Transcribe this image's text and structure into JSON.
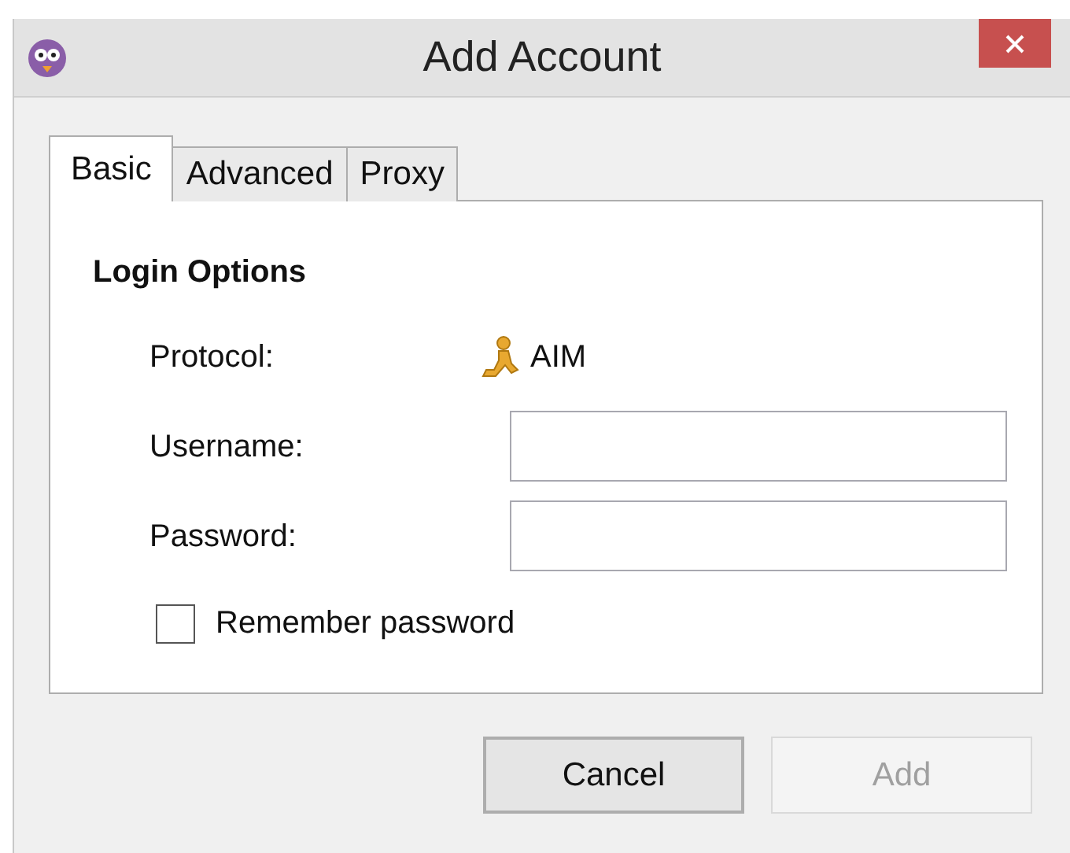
{
  "window": {
    "title": "Add Account"
  },
  "tabs": [
    {
      "label": "Basic",
      "selected": true
    },
    {
      "label": "Advanced",
      "selected": false
    },
    {
      "label": "Proxy",
      "selected": false
    }
  ],
  "section_title": "Login Options",
  "protocol": {
    "label": "Protocol:",
    "value": "AIM"
  },
  "fields": [
    {
      "label": "Username:"
    },
    {
      "label": "Password:"
    }
  ],
  "remember_password": {
    "label": "Remember password",
    "checked": false
  },
  "buttons": [
    {
      "label": "Cancel",
      "disabled": false
    },
    {
      "label": "Add",
      "disabled": true
    }
  ]
}
